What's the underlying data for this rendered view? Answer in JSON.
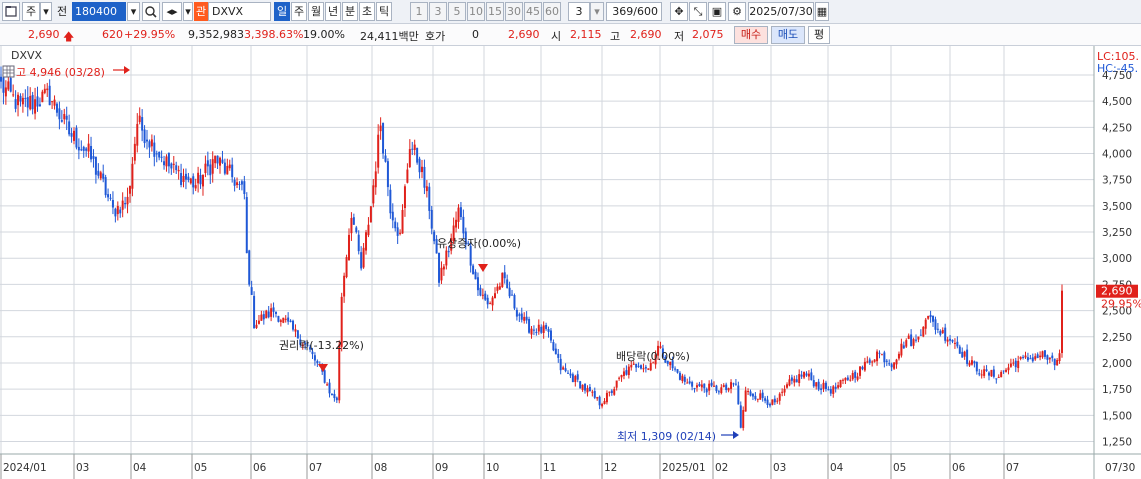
{
  "toolbar": {
    "mode_label": "주",
    "prev_label": "전",
    "code": "180400",
    "badge": "관",
    "name": "DXVX",
    "period_tabs": [
      "일",
      "주",
      "월",
      "년",
      "분",
      "초",
      "틱"
    ],
    "active_period": "일",
    "intervals": [
      "1",
      "3",
      "5",
      "10",
      "15",
      "30",
      "45",
      "60"
    ],
    "interval_input": "3",
    "count": "369/600",
    "date": "2025/07/30"
  },
  "quote": {
    "price": "2,690",
    "change": "620",
    "change_pct": "+29.95%",
    "volume": "9,352,983",
    "volume_pct": "3,398.63%",
    "turnover": "19.00%",
    "amount": "24,411백만",
    "hoga_label": "호가",
    "hoga_value": "0",
    "cur": "2,690",
    "open_label": "시",
    "open": "2,115",
    "high_label": "고",
    "high": "2,690",
    "low_label": "저",
    "low": "2,075",
    "buy_label": "매수",
    "sell_label": "매도",
    "avg_label": "평"
  },
  "colors": {
    "up": "#e0211b",
    "down": "#1f58d6",
    "grid": "#d3d7de"
  },
  "chart_data": {
    "type": "candlestick",
    "legend": "DXVX",
    "legend_right_top": "LC:105.",
    "legend_right_bot": "HC:-45.",
    "ylim": [
      1150,
      4950
    ],
    "y_ticks": [
      1250,
      1500,
      1750,
      2000,
      2250,
      2500,
      2750,
      3000,
      3250,
      3500,
      3750,
      4000,
      4250,
      4500,
      4750
    ],
    "y_tick_labels": [
      "1,250",
      "1,500",
      "1,750",
      "2,000",
      "2,250",
      "2,500",
      "2,750",
      "3,000",
      "3,250",
      "3,500",
      "3,750",
      "4,000",
      "4,250",
      "4,500",
      "4,750"
    ],
    "x_labels": [
      "2024/01",
      "03",
      "04",
      "05",
      "06",
      "07",
      "08",
      "09",
      "10",
      "11",
      "12",
      "2025/01",
      "02",
      "03",
      "04",
      "05",
      "06",
      "07",
      "07/30"
    ],
    "last_price_label": "2,690",
    "last_pct_label": "29.95%",
    "annotations": {
      "high": "고 4,946 (03/28)",
      "low": "최저 1,309 (02/14)",
      "rights": "권리락(-13.22%)",
      "bonus": "유상증자(0.00%)",
      "dividend": "배당락(0.00%)"
    },
    "anchors": [
      [
        0,
        4650
      ],
      [
        8,
        4450
      ],
      [
        20,
        4550
      ],
      [
        28,
        4200
      ],
      [
        36,
        4000
      ],
      [
        42,
        3700
      ],
      [
        46,
        3450
      ],
      [
        52,
        3550
      ],
      [
        56,
        4300
      ],
      [
        62,
        4100
      ],
      [
        70,
        3850
      ],
      [
        80,
        3700
      ],
      [
        88,
        3950
      ],
      [
        96,
        3750
      ],
      [
        100,
        3600
      ],
      [
        101,
        3020
      ],
      [
        104,
        2380
      ],
      [
        112,
        2500
      ],
      [
        118,
        2360
      ],
      [
        126,
        2150
      ],
      [
        132,
        1900
      ],
      [
        136,
        1680
      ],
      [
        138,
        1660
      ],
      [
        140,
        2650
      ],
      [
        144,
        3450
      ],
      [
        148,
        2900
      ],
      [
        152,
        3500
      ],
      [
        156,
        4300
      ],
      [
        160,
        3500
      ],
      [
        164,
        3200
      ],
      [
        168,
        4100
      ],
      [
        172,
        3900
      ],
      [
        176,
        3500
      ],
      [
        180,
        2800
      ],
      [
        184,
        3100
      ],
      [
        188,
        3450
      ],
      [
        192,
        3100
      ],
      [
        196,
        2700
      ],
      [
        200,
        2550
      ],
      [
        206,
        2800
      ],
      [
        212,
        2500
      ],
      [
        216,
        2350
      ],
      [
        224,
        2300
      ],
      [
        230,
        1950
      ],
      [
        238,
        1800
      ],
      [
        246,
        1620
      ],
      [
        250,
        1700
      ],
      [
        256,
        1900
      ],
      [
        262,
        2000
      ],
      [
        266,
        1950
      ],
      [
        270,
        2150
      ],
      [
        276,
        1950
      ],
      [
        282,
        1800
      ],
      [
        290,
        1760
      ],
      [
        298,
        1750
      ],
      [
        302,
        1800
      ],
      [
        304,
        1380
      ],
      [
        306,
        1720
      ],
      [
        312,
        1680
      ],
      [
        318,
        1600
      ],
      [
        324,
        1800
      ],
      [
        330,
        1900
      ],
      [
        336,
        1780
      ],
      [
        342,
        1740
      ],
      [
        348,
        1850
      ],
      [
        354,
        1950
      ],
      [
        360,
        2100
      ],
      [
        366,
        2000
      ],
      [
        372,
        2220
      ],
      [
        376,
        2200
      ],
      [
        380,
        2450
      ],
      [
        386,
        2300
      ],
      [
        392,
        2200
      ],
      [
        398,
        2000
      ],
      [
        404,
        1900
      ],
      [
        410,
        1880
      ],
      [
        416,
        2000
      ],
      [
        422,
        2040
      ],
      [
        428,
        2080
      ],
      [
        433,
        1980
      ],
      [
        435,
        2100
      ],
      [
        436,
        2690
      ]
    ]
  }
}
